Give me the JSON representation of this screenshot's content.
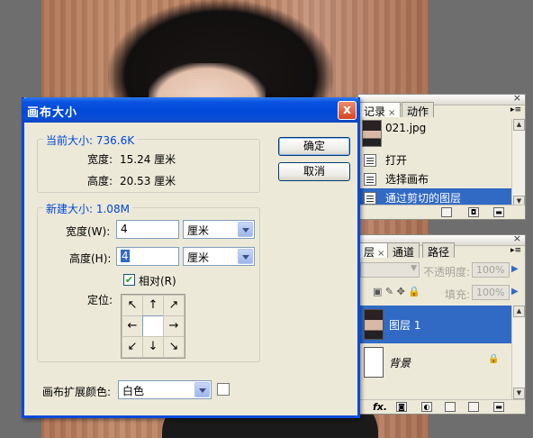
{
  "dialog": {
    "title": "画布大小",
    "close_label": "x",
    "current_size": {
      "legend": "当前大小: 736.6K",
      "width_label": "宽度:",
      "width_value": "15.24 厘米",
      "height_label": "高度:",
      "height_value": "20.53 厘米"
    },
    "new_size": {
      "legend": "新建大小: 1.08M",
      "width_label": "宽度(W):",
      "width_value": "4",
      "width_unit": "厘米",
      "height_label": "高度(H):",
      "height_value": "4",
      "height_unit": "厘米",
      "relative_label": "相对(R)",
      "relative_checked": true,
      "anchor_label": "定位:",
      "anchor_arrows": [
        "↖",
        "↑",
        "↗",
        "←",
        "",
        "→",
        "↙",
        "↓",
        "↘"
      ]
    },
    "extension_color_label": "画布扩展颜色:",
    "extension_color_value": "白色",
    "ok_label": "确定",
    "cancel_label": "取消"
  },
  "history_panel": {
    "tabs": [
      "记录",
      "动作"
    ],
    "snapshot_name": "021.jpg",
    "items": [
      {
        "label": "打开",
        "selected": false
      },
      {
        "label": "选择画布",
        "selected": false
      },
      {
        "label": "通过剪切的图层",
        "selected": true
      }
    ]
  },
  "layers_panel": {
    "tabs": [
      "层",
      "通道",
      "路径"
    ],
    "opacity_label": "不透明度:",
    "opacity_value": "100%",
    "fill_label": "填充:",
    "fill_value": "100%",
    "layers": [
      {
        "name": "图层 1",
        "selected": true
      },
      {
        "name": "背景",
        "selected": false
      }
    ]
  },
  "colors": {
    "accent": "#316ac5",
    "titlebar": "#0a54e0",
    "group_legend": "#0046d5"
  }
}
